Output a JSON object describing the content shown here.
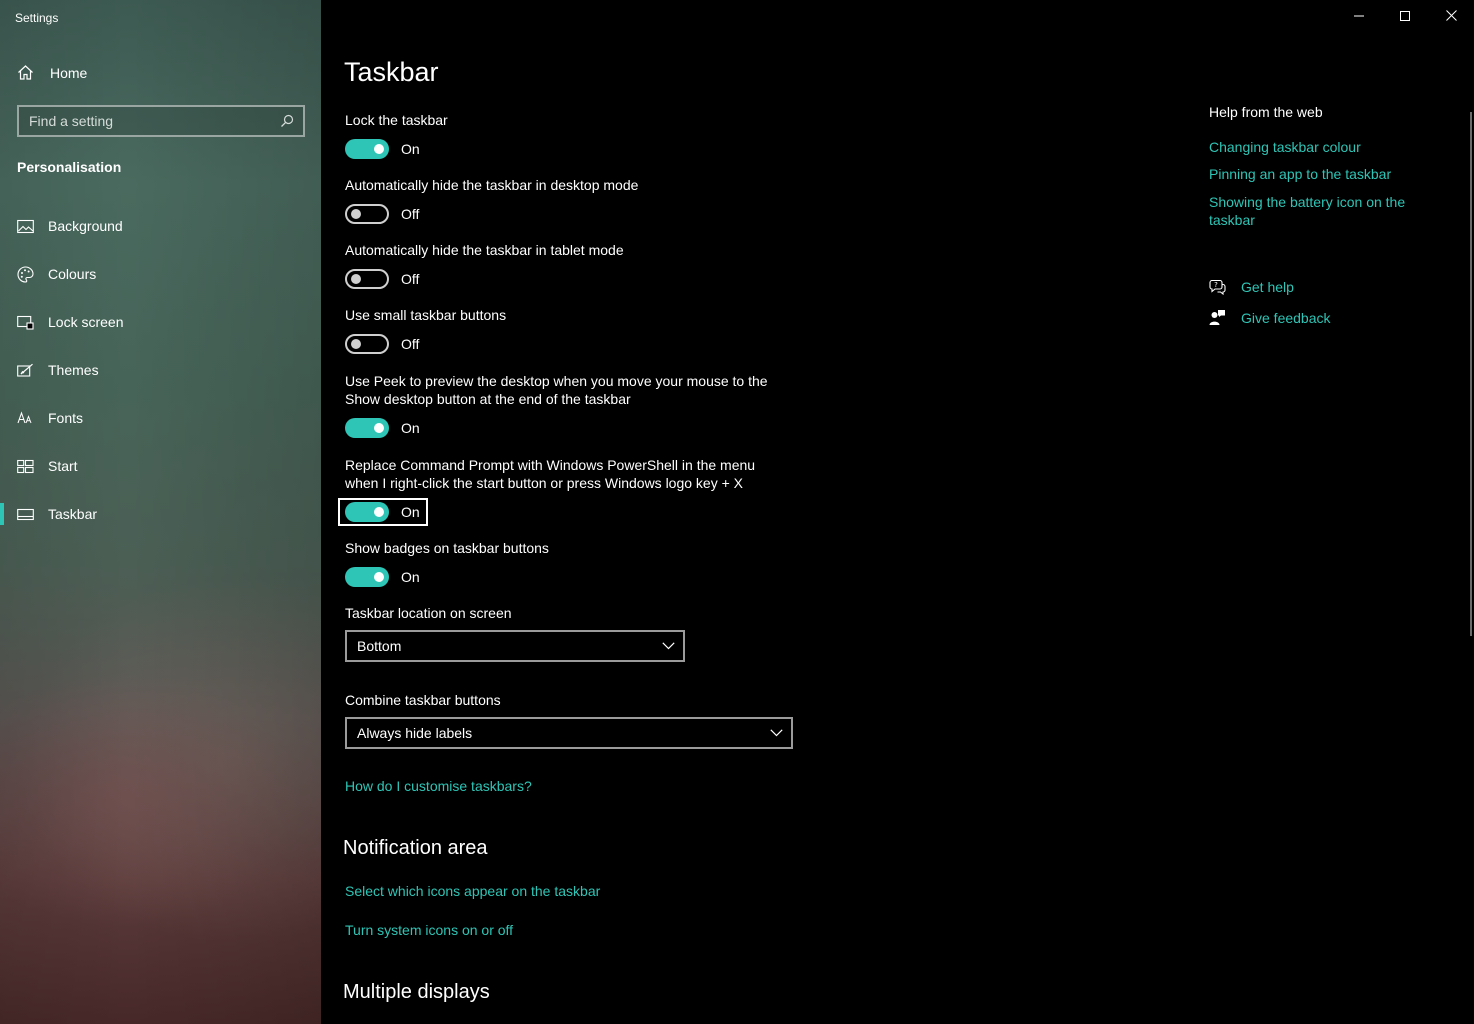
{
  "window": {
    "app_title": "Settings"
  },
  "sidebar": {
    "home_label": "Home",
    "search_placeholder": "Find a setting",
    "section_label": "Personalisation",
    "items": [
      {
        "label": "Background",
        "icon": "image-icon"
      },
      {
        "label": "Colours",
        "icon": "palette-icon"
      },
      {
        "label": "Lock screen",
        "icon": "lock-screen-icon"
      },
      {
        "label": "Themes",
        "icon": "themes-brush-icon"
      },
      {
        "label": "Fonts",
        "icon": "fonts-icon"
      },
      {
        "label": "Start",
        "icon": "start-tiles-icon"
      },
      {
        "label": "Taskbar",
        "icon": "taskbar-icon",
        "active": true
      }
    ]
  },
  "main": {
    "title": "Taskbar",
    "settings": [
      {
        "label": "Lock the taskbar",
        "state": "On"
      },
      {
        "label": "Automatically hide the taskbar in desktop mode",
        "state": "Off"
      },
      {
        "label": "Automatically hide the taskbar in tablet mode",
        "state": "Off"
      },
      {
        "label": "Use small taskbar buttons",
        "state": "Off"
      },
      {
        "label_line1": "Use Peek to preview the desktop when you move your mouse to the",
        "label_line2": "Show desktop button at the end of the taskbar",
        "state": "On"
      },
      {
        "label_line1": "Replace Command Prompt with Windows PowerShell in the menu",
        "label_line2": "when I right-click the start button or press Windows logo key + X",
        "state": "On"
      },
      {
        "label": "Show badges on taskbar buttons",
        "state": "On"
      }
    ],
    "location": {
      "label": "Taskbar location on screen",
      "value": "Bottom"
    },
    "combine": {
      "label": "Combine taskbar buttons",
      "value": "Always hide labels"
    },
    "customise_link": "How do I customise taskbars?",
    "notification_area": {
      "title": "Notification area",
      "link1": "Select which icons appear on the taskbar",
      "link2": "Turn system icons on or off"
    },
    "multiple_displays": {
      "title": "Multiple displays"
    }
  },
  "help": {
    "title": "Help from the web",
    "links": [
      "Changing taskbar colour",
      "Pinning an app to the taskbar",
      "Showing the battery icon on the taskbar"
    ],
    "get_help": "Get help",
    "give_feedback": "Give feedback"
  },
  "colors": {
    "accent": "#2ec5b6"
  }
}
